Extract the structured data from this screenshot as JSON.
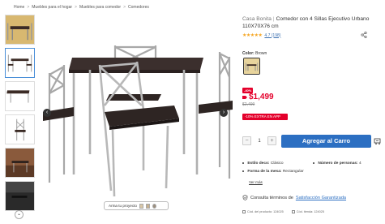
{
  "breadcrumb": {
    "items": [
      "Home",
      "Muebles para el hogar",
      "Muebles para comedor",
      "Comedores"
    ],
    "separator": ">"
  },
  "product": {
    "brand": "Casa Bonita",
    "separator": "|",
    "title": "Comedor con 4 Sillas Ejecutivo Urbano 110X70X76 cm",
    "rating_value": 4.7,
    "rating_text": "4.7 (198)",
    "color_label": "Color:",
    "color_value": "Brown",
    "discount_badge": "-40%",
    "price": "$1,499",
    "old_price": "$2,499",
    "app_promo": "-10% EXTRA EN APP",
    "quantity": "1",
    "qty_minus": "−",
    "qty_plus": "+",
    "add_to_cart": "Agregar al Carro",
    "specs": [
      {
        "label": "Estilo deco:",
        "value": "Clásico"
      },
      {
        "label": "Número de personas:",
        "value": "4"
      },
      {
        "label": "Forma de la mesa:",
        "value": "Rectangular"
      }
    ],
    "see_more": "Ver más",
    "consult_prefix": "Consulta términos de",
    "consult_link": "Satisfacción Garantizada",
    "code_store": "Cód. del producto: 124025",
    "code_seller": "Cód. tienda: 124025"
  },
  "gallery": {
    "arma_label": "Arma tu proyecto",
    "prev_glyph": "‹",
    "next_glyph": "›",
    "zoom_glyph": "⌄"
  },
  "colors": {
    "accent_blue": "#2c6fc2",
    "price_red": "#e4002b",
    "star": "#f5a623"
  }
}
